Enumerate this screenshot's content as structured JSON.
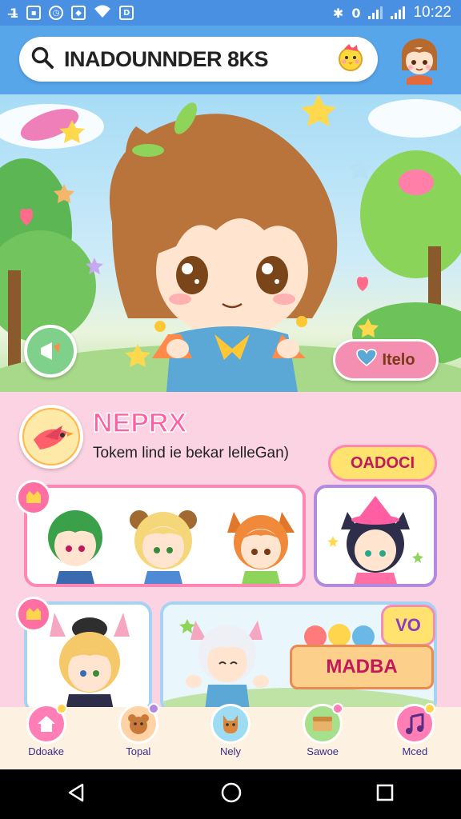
{
  "status_bar": {
    "time": "10:22",
    "left_icons": [
      "notification-icon",
      "photo-icon",
      "alarm-icon",
      "tag-icon",
      "wifi-icon",
      "storage-icon"
    ],
    "right_icons": [
      "bluetooth-icon",
      "vibrate-icon",
      "signal-icon",
      "signal-icon"
    ]
  },
  "header": {
    "search_text": "INADOUNNDER 8KS",
    "search_icon": "search-icon"
  },
  "hero": {
    "hello_label": "Itelo"
  },
  "profile": {
    "title": "NEPRX",
    "subtitle": "Tokem lind ie bekar lelleGan)",
    "pill_label": "OADOCI"
  },
  "madba_label": "MADBA",
  "vo_label": "VO",
  "bottom_nav": [
    {
      "label": "Ddoake",
      "icon": "home-icon",
      "color": "#ff7eb6"
    },
    {
      "label": "Topal",
      "icon": "bear-icon",
      "color": "#ffd3a6"
    },
    {
      "label": "Nely",
      "icon": "cat-icon",
      "color": "#9ddcf3"
    },
    {
      "label": "Sawoe",
      "icon": "box-icon",
      "color": "#a7e08a"
    },
    {
      "label": "Mced",
      "icon": "music-icon",
      "color": "#ff7eb6"
    }
  ],
  "colors": {
    "header_bg": "#58a6ea",
    "status_bg": "#4a90e2",
    "accent_pink": "#ff5fa2",
    "content_bg": "#fbd3e2"
  }
}
